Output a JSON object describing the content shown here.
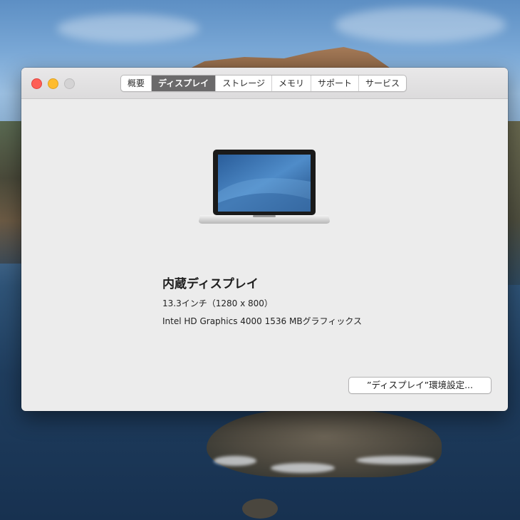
{
  "window": {
    "tabs": [
      {
        "label": "概要",
        "active": false
      },
      {
        "label": "ディスプレイ",
        "active": true
      },
      {
        "label": "ストレージ",
        "active": false
      },
      {
        "label": "メモリ",
        "active": false
      },
      {
        "label": "サポート",
        "active": false
      },
      {
        "label": "サービス",
        "active": false
      }
    ]
  },
  "display": {
    "name": "内蔵ディスプレイ",
    "size": "13.3インチ（1280 x 800）",
    "graphics": "Intel HD Graphics 4000 1536 MBグラフィックス"
  },
  "buttons": {
    "display_prefs": "”ディスプレイ”環境設定..."
  },
  "colors": {
    "close": "#fe5f57",
    "minimize": "#febc2e",
    "zoom_disabled": "#d4d3d4",
    "active_tab": "#6b6a6b"
  },
  "icons": {
    "device": "macbook-laptop-icon"
  }
}
